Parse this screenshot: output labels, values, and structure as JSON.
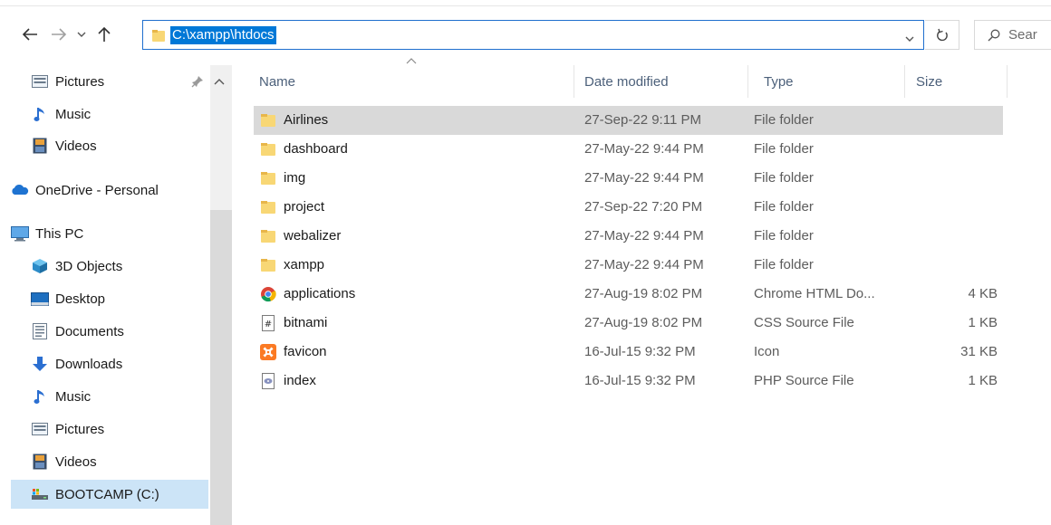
{
  "address_bar": {
    "path": "C:\\xampp\\htdocs",
    "search_placeholder": "Sear"
  },
  "sidebar": {
    "items": [
      {
        "label": "Pictures",
        "icon": "pictures-icon"
      },
      {
        "label": "Music",
        "icon": "music-icon"
      },
      {
        "label": "Videos",
        "icon": "videos-icon"
      },
      {
        "label": "OneDrive - Personal",
        "icon": "onedrive-icon"
      },
      {
        "label": "This PC",
        "icon": "this-pc-icon"
      },
      {
        "label": "3D Objects",
        "icon": "3d-objects-icon"
      },
      {
        "label": "Desktop",
        "icon": "desktop-icon"
      },
      {
        "label": "Documents",
        "icon": "documents-icon"
      },
      {
        "label": "Downloads",
        "icon": "downloads-icon"
      },
      {
        "label": "Music",
        "icon": "music-icon"
      },
      {
        "label": "Pictures",
        "icon": "pictures-icon"
      },
      {
        "label": "Videos",
        "icon": "videos-icon"
      },
      {
        "label": "BOOTCAMP (C:)",
        "icon": "drive-icon"
      }
    ]
  },
  "columns": {
    "name": "Name",
    "date": "Date modified",
    "type": "Type",
    "size": "Size"
  },
  "files": [
    {
      "name": "Airlines",
      "date": "27-Sep-22 9:11 PM",
      "type": "File folder",
      "size": "",
      "icon": "folder-icon"
    },
    {
      "name": "dashboard",
      "date": "27-May-22 9:44 PM",
      "type": "File folder",
      "size": "",
      "icon": "folder-icon"
    },
    {
      "name": "img",
      "date": "27-May-22 9:44 PM",
      "type": "File folder",
      "size": "",
      "icon": "folder-icon"
    },
    {
      "name": "project",
      "date": "27-Sep-22 7:20 PM",
      "type": "File folder",
      "size": "",
      "icon": "folder-icon"
    },
    {
      "name": "webalizer",
      "date": "27-May-22 9:44 PM",
      "type": "File folder",
      "size": "",
      "icon": "folder-icon"
    },
    {
      "name": "xampp",
      "date": "27-May-22 9:44 PM",
      "type": "File folder",
      "size": "",
      "icon": "folder-icon"
    },
    {
      "name": "applications",
      "date": "27-Aug-19 8:02 PM",
      "type": "Chrome HTML Do...",
      "size": "4 KB",
      "icon": "chrome-icon"
    },
    {
      "name": "bitnami",
      "date": "27-Aug-19 8:02 PM",
      "type": "CSS Source File",
      "size": "1 KB",
      "icon": "css-file-icon"
    },
    {
      "name": "favicon",
      "date": "16-Jul-15 9:32 PM",
      "type": "Icon",
      "size": "31 KB",
      "icon": "xampp-icon"
    },
    {
      "name": "index",
      "date": "16-Jul-15 9:32 PM",
      "type": "PHP Source File",
      "size": "1 KB",
      "icon": "php-file-icon"
    }
  ],
  "colors": {
    "accent": "#0078d7",
    "selected_row": "#d9d9d9",
    "nav_selected": "#cce4f7",
    "folder": "#f8d775"
  }
}
